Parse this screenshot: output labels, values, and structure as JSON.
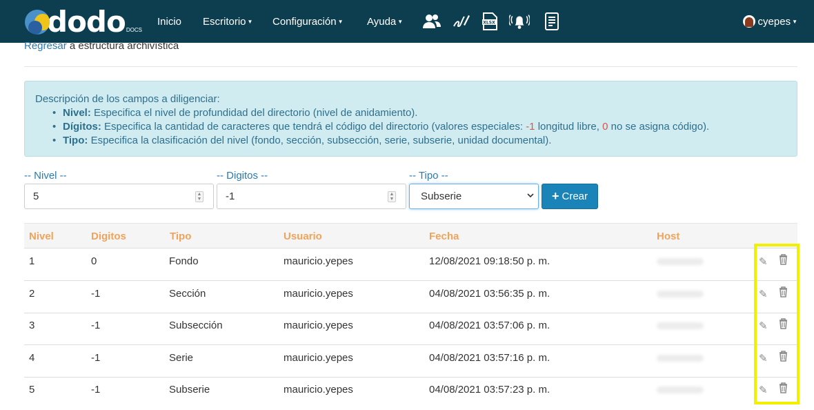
{
  "nav": {
    "logo": "dodo",
    "logo_sub": "DOCS",
    "items": [
      {
        "label": "Inicio"
      },
      {
        "label": "Escritorio"
      },
      {
        "label": "Configuración"
      },
      {
        "label": "Ayuda"
      }
    ],
    "icons": [
      "users-icon",
      "signature-icon",
      "xlsx-icon",
      "bell-icon",
      "document-list-icon"
    ],
    "user": "cyepes"
  },
  "breadcrumb": {
    "link": "Regresar",
    "rest": "a estructura archivística"
  },
  "info": {
    "title": "Descripción de los campos a diligenciar:",
    "nivel_label": "Nivel:",
    "nivel_text": "Especifica el nivel de profundidad del directorio (nivel de anidamiento).",
    "digitos_label": "Dígitos:",
    "digitos_text_a": "Especifica la cantidad de caracteres que tendrá el código del directorio (valores especiales:",
    "digitos_special_1": "-1",
    "digitos_text_b": "longitud libre,",
    "digitos_special_2": "0",
    "digitos_text_c": "no se asigna código).",
    "tipo_label": "Tipo:",
    "tipo_text": "Especifica la clasificación del nivel (fondo, sección, subsección, serie, subserie, unidad documental)."
  },
  "form": {
    "nivel_label": "-- Nivel --",
    "nivel_value": "5",
    "digitos_label": "-- Digitos --",
    "digitos_value": "-1",
    "tipo_label": "-- Tipo --",
    "tipo_value": "Subserie",
    "crear": "Crear"
  },
  "table": {
    "headers": [
      "Nivel",
      "Digitos",
      "Tipo",
      "Usuario",
      "Fecha",
      "Host"
    ],
    "rows": [
      {
        "nivel": "1",
        "digitos": "0",
        "tipo": "Fondo",
        "usuario": "mauricio.yepes",
        "fecha": "12/08/2021 09:18:50 p. m."
      },
      {
        "nivel": "2",
        "digitos": "-1",
        "tipo": "Sección",
        "usuario": "mauricio.yepes",
        "fecha": "04/08/2021 03:56:35 p. m."
      },
      {
        "nivel": "3",
        "digitos": "-1",
        "tipo": "Subsección",
        "usuario": "mauricio.yepes",
        "fecha": "04/08/2021 03:57:06 p. m."
      },
      {
        "nivel": "4",
        "digitos": "-1",
        "tipo": "Serie",
        "usuario": "mauricio.yepes",
        "fecha": "04/08/2021 03:57:16 p. m."
      },
      {
        "nivel": "5",
        "digitos": "-1",
        "tipo": "Subserie",
        "usuario": "mauricio.yepes",
        "fecha": "04/08/2021 03:57:23 p. m."
      }
    ]
  },
  "colors": {
    "navbar": "#0d3e4f",
    "header_text": "#f0a35a",
    "highlight": "#f0f000",
    "button": "#1a84b8"
  }
}
